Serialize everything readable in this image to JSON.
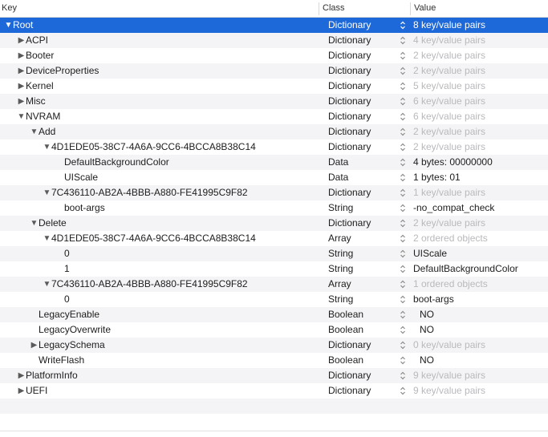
{
  "columns": {
    "key": "Key",
    "class": "Class",
    "value": "Value"
  },
  "rows": [
    {
      "key": "Root",
      "depth": 0,
      "expand": "open",
      "class": "Dictionary",
      "value": "8 key/value pairs",
      "muted": false,
      "selected": true
    },
    {
      "key": "ACPI",
      "depth": 1,
      "expand": "closed",
      "class": "Dictionary",
      "value": "4 key/value pairs",
      "muted": true
    },
    {
      "key": "Booter",
      "depth": 1,
      "expand": "closed",
      "class": "Dictionary",
      "value": "2 key/value pairs",
      "muted": true
    },
    {
      "key": "DeviceProperties",
      "depth": 1,
      "expand": "closed",
      "class": "Dictionary",
      "value": "2 key/value pairs",
      "muted": true
    },
    {
      "key": "Kernel",
      "depth": 1,
      "expand": "closed",
      "class": "Dictionary",
      "value": "5 key/value pairs",
      "muted": true
    },
    {
      "key": "Misc",
      "depth": 1,
      "expand": "closed",
      "class": "Dictionary",
      "value": "6 key/value pairs",
      "muted": true
    },
    {
      "key": "NVRAM",
      "depth": 1,
      "expand": "open",
      "class": "Dictionary",
      "value": "6 key/value pairs",
      "muted": true
    },
    {
      "key": "Add",
      "depth": 2,
      "expand": "open",
      "class": "Dictionary",
      "value": "2 key/value pairs",
      "muted": true
    },
    {
      "key": "4D1EDE05-38C7-4A6A-9CC6-4BCCA8B38C14",
      "depth": 3,
      "expand": "open",
      "class": "Dictionary",
      "value": "2 key/value pairs",
      "muted": true
    },
    {
      "key": "DefaultBackgroundColor",
      "depth": 4,
      "expand": "none",
      "class": "Data",
      "value": "4 bytes: 00000000",
      "muted": false
    },
    {
      "key": "UIScale",
      "depth": 4,
      "expand": "none",
      "class": "Data",
      "value": "1 bytes: 01",
      "muted": false
    },
    {
      "key": "7C436110-AB2A-4BBB-A880-FE41995C9F82",
      "depth": 3,
      "expand": "open",
      "class": "Dictionary",
      "value": "1 key/value pairs",
      "muted": true
    },
    {
      "key": "boot-args",
      "depth": 4,
      "expand": "none",
      "class": "String",
      "value": "-no_compat_check",
      "muted": false
    },
    {
      "key": "Delete",
      "depth": 2,
      "expand": "open",
      "class": "Dictionary",
      "value": "2 key/value pairs",
      "muted": true
    },
    {
      "key": "4D1EDE05-38C7-4A6A-9CC6-4BCCA8B38C14",
      "depth": 3,
      "expand": "open",
      "class": "Array",
      "value": "2 ordered objects",
      "muted": true
    },
    {
      "key": "0",
      "depth": 4,
      "expand": "none",
      "class": "String",
      "value": "UIScale",
      "muted": false
    },
    {
      "key": "1",
      "depth": 4,
      "expand": "none",
      "class": "String",
      "value": "DefaultBackgroundColor",
      "muted": false
    },
    {
      "key": "7C436110-AB2A-4BBB-A880-FE41995C9F82",
      "depth": 3,
      "expand": "open",
      "class": "Array",
      "value": "1 ordered objects",
      "muted": true
    },
    {
      "key": "0",
      "depth": 4,
      "expand": "none",
      "class": "String",
      "value": "boot-args",
      "muted": false
    },
    {
      "key": "LegacyEnable",
      "depth": 2,
      "expand": "none",
      "class": "Boolean",
      "value": "NO",
      "muted": false,
      "bool": true
    },
    {
      "key": "LegacyOverwrite",
      "depth": 2,
      "expand": "none",
      "class": "Boolean",
      "value": "NO",
      "muted": false,
      "bool": true
    },
    {
      "key": "LegacySchema",
      "depth": 2,
      "expand": "closed",
      "class": "Dictionary",
      "value": "0 key/value pairs",
      "muted": true
    },
    {
      "key": "WriteFlash",
      "depth": 2,
      "expand": "none",
      "class": "Boolean",
      "value": "NO",
      "muted": false,
      "bool": true
    },
    {
      "key": "PlatformInfo",
      "depth": 1,
      "expand": "closed",
      "class": "Dictionary",
      "value": "9 key/value pairs",
      "muted": true
    },
    {
      "key": "UEFI",
      "depth": 1,
      "expand": "closed",
      "class": "Dictionary",
      "value": "9 key/value pairs",
      "muted": true
    }
  ],
  "colors": {
    "selection": "#1e69d9",
    "muted_text": "#b9b9bd",
    "alt_row": "#f4f4f6"
  }
}
